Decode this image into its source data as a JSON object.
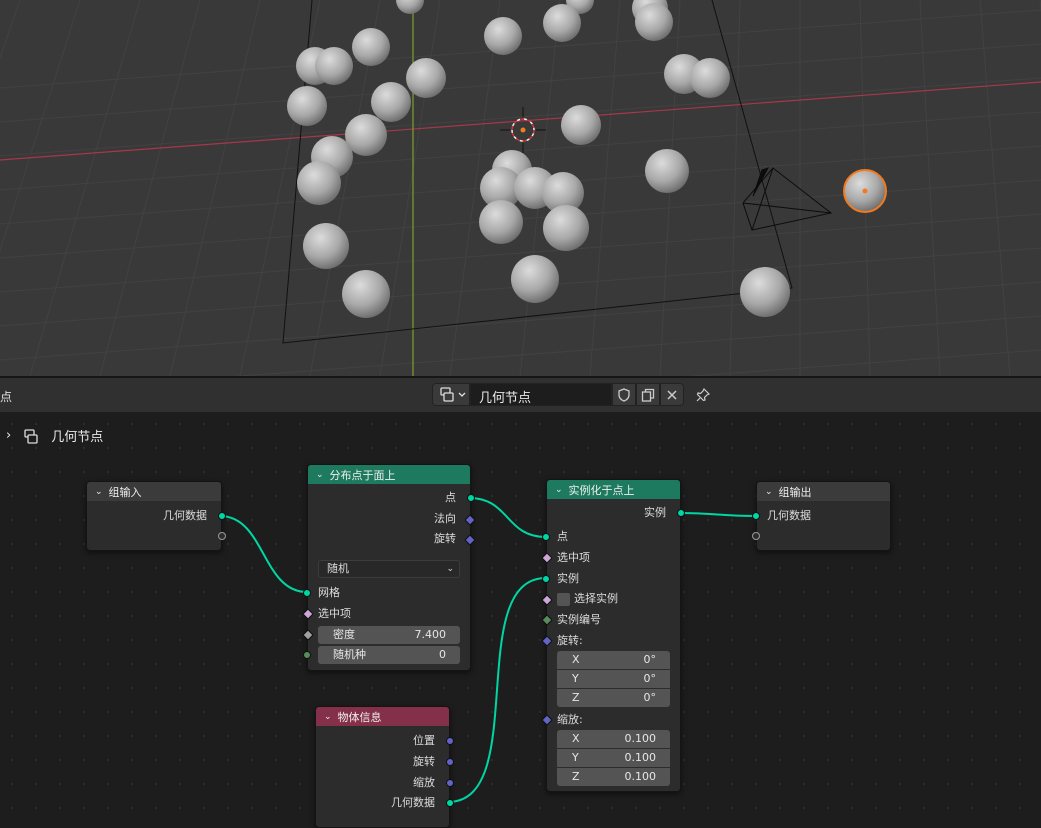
{
  "header": {
    "left_text": "点",
    "tree_name": "几何节点"
  },
  "breadcrumb": {
    "label": "几何节点"
  },
  "nodes": {
    "group_input": {
      "title": "组输入",
      "out_geometry": "几何数据"
    },
    "distribute": {
      "title": "分布点于面上",
      "out_points": "点",
      "out_normal": "法向",
      "out_rotation": "旋转",
      "mode": "随机",
      "in_mesh": "网格",
      "in_selection": "选中项",
      "density_label": "密度",
      "density_value": "7.400",
      "seed_label": "随机种",
      "seed_value": "0"
    },
    "instance": {
      "title": "实例化于点上",
      "out_instances": "实例",
      "in_points": "点",
      "in_selection": "选中项",
      "in_instance": "实例",
      "pick_instance": "选择实例",
      "instance_index": "实例编号",
      "rotation_label": "旋转:",
      "rot_x_label": "X",
      "rot_x": "0°",
      "rot_y_label": "Y",
      "rot_y": "0°",
      "rot_z_label": "Z",
      "rot_z": "0°",
      "scale_label": "缩放:",
      "sc_x_label": "X",
      "sc_x": "0.100",
      "sc_y_label": "Y",
      "sc_y": "0.100",
      "sc_z_label": "Z",
      "sc_z": "0.100"
    },
    "group_output": {
      "title": "组输出",
      "in_geometry": "几何数据"
    },
    "object_info": {
      "title": "物体信息",
      "out_location": "位置",
      "out_rotation": "旋转",
      "out_scale": "缩放",
      "out_geometry": "几何数据"
    }
  },
  "colors": {
    "geometry_socket": "#00d6a3",
    "vector_socket": "#6363c7",
    "geometry_node_header": "#1e7a5e",
    "input_node_header": "#84304a",
    "selected_outline": "#f37a1d",
    "x_axis": "#a5384a",
    "y_axis": "#7fa02a"
  }
}
